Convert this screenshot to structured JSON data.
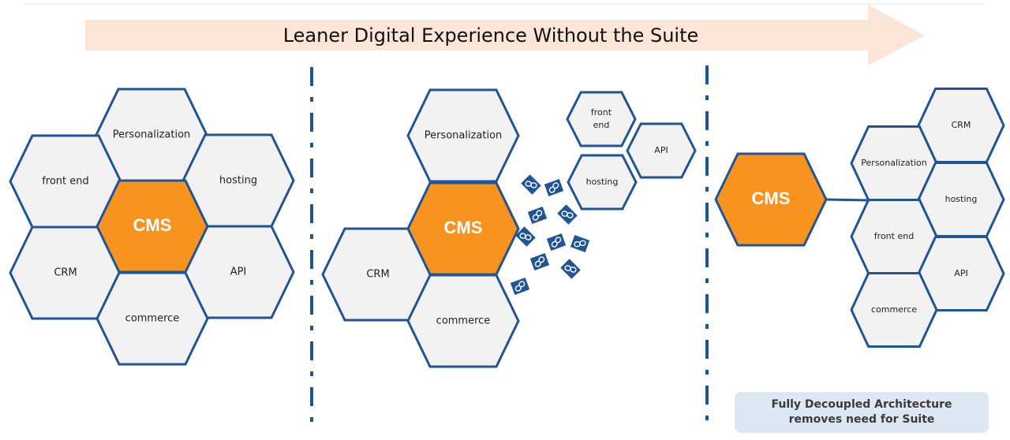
{
  "banner": {
    "title": "Leaner Digital Experience Without the Suite",
    "color": "#fbe5d6"
  },
  "colors": {
    "outline": "#1f5496",
    "hex_fill": "#f2f2f2",
    "core_fill": "#f7931e",
    "note_bg": "#dde8f4"
  },
  "panels": [
    {
      "name": "suite",
      "core": "CMS",
      "modules": [
        "Personalization",
        "front end",
        "hosting",
        "CRM",
        "API",
        "commerce"
      ]
    },
    {
      "name": "breaking-apart",
      "core": "CMS",
      "attached_modules": [
        "Personalization",
        "CRM",
        "commerce"
      ],
      "detached_modules": [
        "front end",
        "API",
        "hosting"
      ],
      "broken_link_icon_count": 11
    },
    {
      "name": "decoupled",
      "core": "CMS",
      "modules": [
        "CRM",
        "Personalization",
        "hosting",
        "front end",
        "API",
        "commerce"
      ]
    }
  ],
  "note": {
    "line1": "Fully Decoupled Architecture",
    "line2": "removes need for Suite"
  }
}
